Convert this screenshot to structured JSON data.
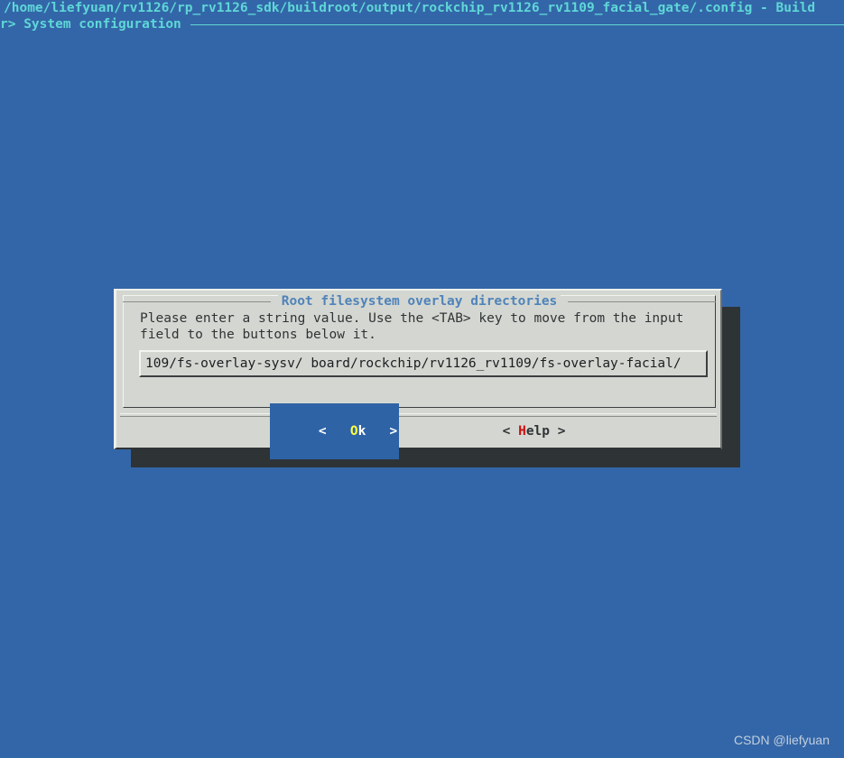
{
  "colors": {
    "background": "#3366a8",
    "terminal_text": "#5fd7d7",
    "dialog_background": "#d4d7d1",
    "dialog_title": "#4f83ba",
    "selected_button_bg": "#2e63a6",
    "hotkey_ok": "#ffff44",
    "hotkey_help": "#cc1111",
    "shadow": "#2e3336",
    "watermark": "#c2cfdd"
  },
  "terminal": {
    "title_line": "/home/liefyuan/rv1126/rp_rv1126_sdk/buildroot/output/rockchip_rv1126_rv1109_facial_gate/.config - Build",
    "breadcrumb": "r> System configuration"
  },
  "dialog": {
    "title": "Root filesystem overlay directories",
    "prompt": "Please enter a string value. Use the <TAB> key to move from the input\nfield to the buttons below it.",
    "input": {
      "value": "109/fs-overlay-sysv/ board/rockchip/rv1126_rv1109/fs-overlay-facial/",
      "placeholder": ""
    },
    "buttons": [
      {
        "id": "ok",
        "selected": true,
        "left_bracket": "<",
        "hotkey": "O",
        "rest": "k",
        "right_bracket": ">",
        "gap_before_hotkey": "   ",
        "gap_after_text": "   "
      },
      {
        "id": "help",
        "selected": false,
        "left_bracket": "<",
        "hotkey": "H",
        "rest": "elp",
        "right_bracket": ">",
        "gap_before_hotkey": " ",
        "gap_after_text": " "
      }
    ]
  },
  "watermark": "CSDN @liefyuan"
}
